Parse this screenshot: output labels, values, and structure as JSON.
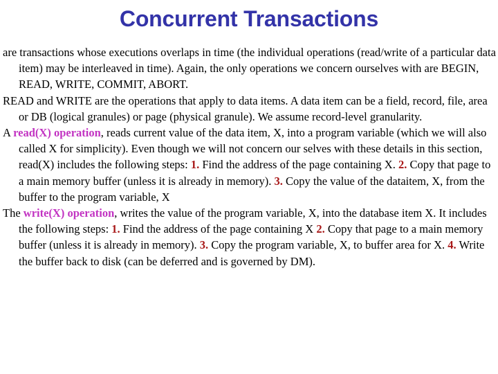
{
  "slide": {
    "title": "Concurrent Transactions",
    "title_color": "#3333a8",
    "background_color": "#ffffff",
    "body_color": "#000000",
    "term_color": "#c233c2",
    "stepnum_color": "#a81818",
    "paragraphs": {
      "p1": {
        "text": "are transactions whose executions overlaps in time (the individual operations (read/write of a particular data item) may be interleaved in time).  Again, the only operations we concern ourselves with are BEGIN, READ, WRITE, COMMIT, ABORT."
      },
      "p2": {
        "text": "READ and WRITE are the operations that apply to data items.  A data item can be a field, record, file, area or DB (logical granules) or page (physical granule).  We assume record-level granularity."
      },
      "p3": {
        "lead": "A ",
        "term": "read(X) operation",
        "seg1": ", reads current value of the data item, X, into a program variable (which we will also called X for simplicity). Even though we will not concern our selves with these details in this section, read(X) includes the following steps: ",
        "step1": "1.",
        "seg2": " Find the address of the page containing X.   ",
        "step2": "2.",
        "seg3": " Copy that page to a main memory buffer (unless it is already in memory).   ",
        "step3": "3.",
        "seg4": " Copy the value of the dataitem, X, from the buffer to the program variable, X"
      },
      "p4": {
        "lead": "The ",
        "term": "write(X) operation",
        "seg1": ", writes the value of the program variable, X, into the database item X. It includes the following steps: ",
        "step1": "1.",
        "seg2": " Find the address of the page containing X ",
        "step2": "2.",
        "seg3": " Copy that page to a main memory buffer (unless it is already in memory). ",
        "step3": "3.",
        "seg4": " Copy the program variable, X, to buffer area for X.  ",
        "step4": "4.",
        "seg5": " Write the buffer back to disk (can be deferred and is governed by DM)."
      }
    }
  }
}
